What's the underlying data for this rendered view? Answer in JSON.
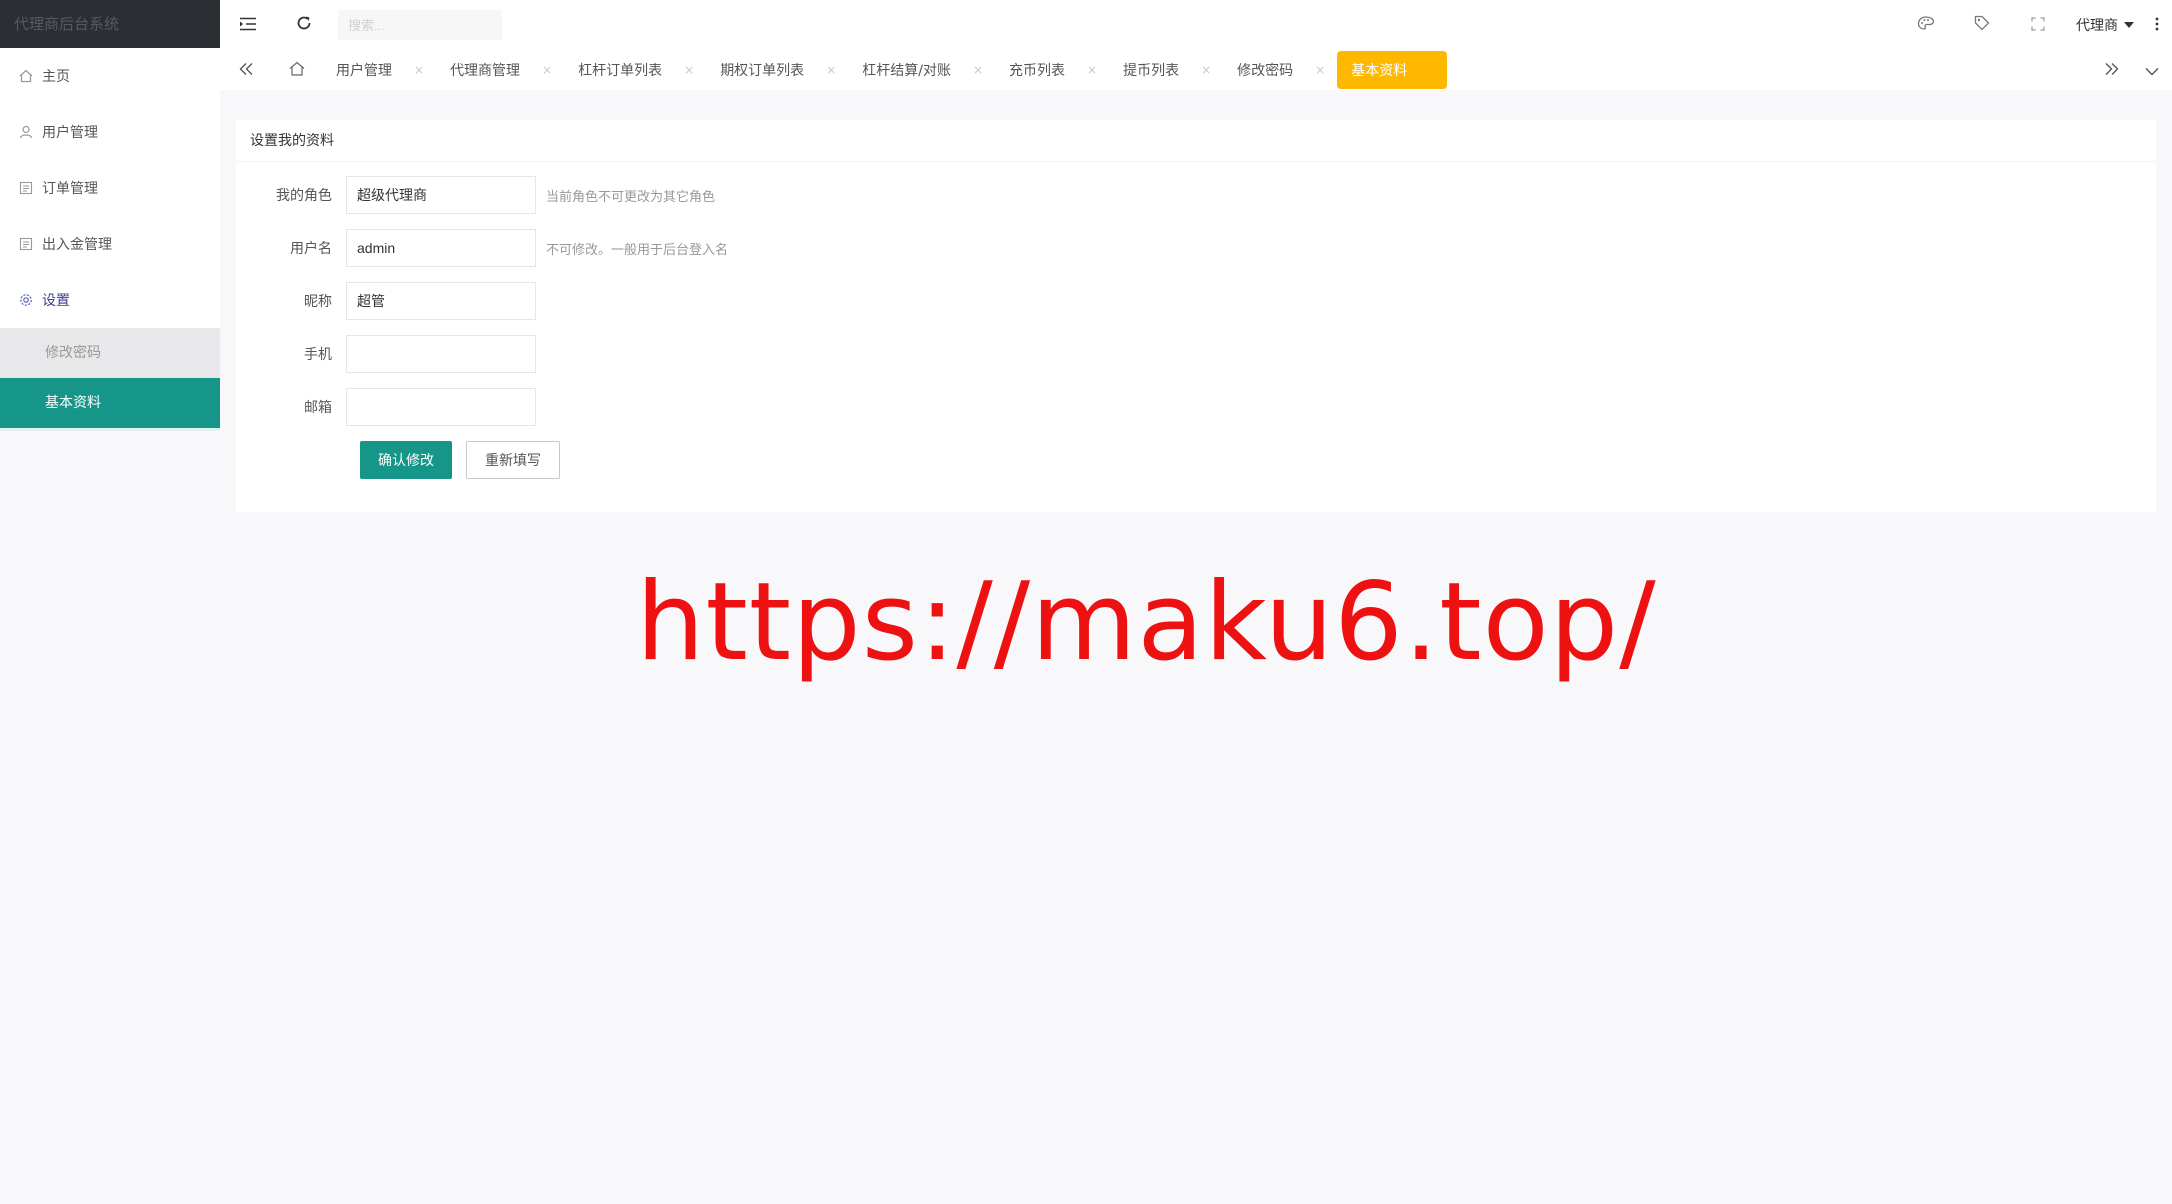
{
  "sidebar": {
    "logo": "代理商后台系统",
    "items": [
      {
        "label": "主页",
        "icon": "home-icon"
      },
      {
        "label": "用户管理",
        "icon": "user-icon"
      },
      {
        "label": "订单管理",
        "icon": "list-icon"
      },
      {
        "label": "出入金管理",
        "icon": "list-icon"
      },
      {
        "label": "设置",
        "icon": "gear-icon"
      }
    ],
    "submenu": [
      {
        "label": "修改密码"
      },
      {
        "label": "基本资料"
      }
    ]
  },
  "header": {
    "search_placeholder": "搜索...",
    "user": "代理商"
  },
  "tabs": [
    {
      "label": "用户管理"
    },
    {
      "label": "代理商管理"
    },
    {
      "label": "杠杆订单列表"
    },
    {
      "label": "期权订单列表"
    },
    {
      "label": "杠杆结算/对账"
    },
    {
      "label": "充币列表"
    },
    {
      "label": "提币列表"
    },
    {
      "label": "修改密码"
    },
    {
      "label": "基本资料"
    }
  ],
  "tab_close": "×",
  "card": {
    "title": "设置我的资料",
    "fields": [
      {
        "label": "我的角色",
        "value": "超级代理商",
        "hint": "当前角色不可更改为其它角色"
      },
      {
        "label": "用户名",
        "value": "admin",
        "hint": "不可修改。一般用于后台登入名"
      },
      {
        "label": "昵称",
        "value": "超管"
      },
      {
        "label": "手机",
        "value": ""
      },
      {
        "label": "邮箱",
        "value": ""
      }
    ],
    "submit": "确认修改",
    "reset": "重新填写"
  },
  "watermark": "https://maku6.top/",
  "colors": {
    "primary": "#159688",
    "active_tab": "#ffb800",
    "logo_bg": "#2b2e33",
    "watermark": "#ee1111"
  }
}
